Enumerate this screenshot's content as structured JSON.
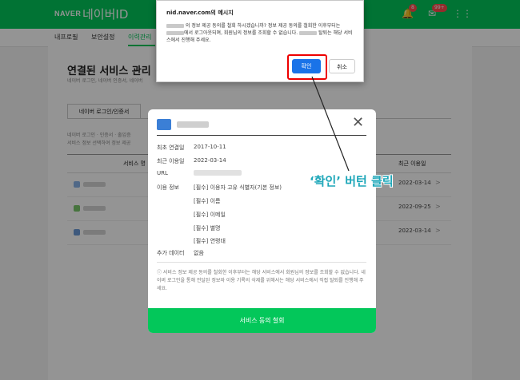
{
  "header": {
    "logo": "NAVER",
    "service": "네이버ID",
    "notif_badge": "8",
    "mail_badge": "99+"
  },
  "subnav": [
    "내프로필",
    "보안설정",
    "이력관리"
  ],
  "page": {
    "title": "연결된 서비스 관리",
    "desc": "네이버 로그인, 네이버 인증서, 네이버",
    "tab_active": "네이버 로그인/인증서",
    "note_line1": "네이버 로그인 · 인증서 · 출입증",
    "note_line2": "서비스 정보 선택하여 정보 제공",
    "col_service": "서비스 명",
    "col_last": "최근 이용일",
    "rows": [
      {
        "date": "2022-03-14"
      },
      {
        "date": "2022-09-25"
      },
      {
        "date": "2022-03-14"
      }
    ]
  },
  "modal": {
    "first_label": "최초 연결일",
    "first_value": "2017-10-11",
    "recent_label": "최근 이용일",
    "recent_value": "2022-03-14",
    "url_label": "URL",
    "use_label": "이용 정보",
    "use_items": [
      "[필수] 이용자 고유 식별자(기본 정보)",
      "[필수] 이름",
      "[필수] 이메일",
      "[필수] 별명",
      "[필수] 연령대"
    ],
    "extra_label": "추가 데이터",
    "extra_value": "없음",
    "info": "ⓘ 서비스 정보 제공 동의를 철회한 이후부터는 해당 서비스에서 회원님의 정보를 조회할 수 없습니다. 네이버 로그인을 통해 전달된 정보와 이용 기록의 삭제를 위해서는 해당 서비스에서 직접 탈퇴를 진행해 주세요.",
    "button": "서비스 동의 철회"
  },
  "dialog": {
    "title": "nid.naver.com의 메시지",
    "msg_a": "의 정보 제공 동의를 철회 하시겠습니까? 정보 제공 동의를 철회한 이후부터는",
    "msg_b": "에서 로그아웃되며, 회원님의 정보를 조회할 수 없습니다.",
    "msg_c": "탈퇴는 해당 서비스에서 진행해 주세요.",
    "ok": "확인",
    "cancel": "취소"
  },
  "annotation": "‘확인’ 버턴 클릭",
  "colors": {
    "brand": "#03c75a",
    "primary_button": "#1a73e8",
    "highlight": "#ee0000",
    "annotation": "#1ea7b9"
  }
}
